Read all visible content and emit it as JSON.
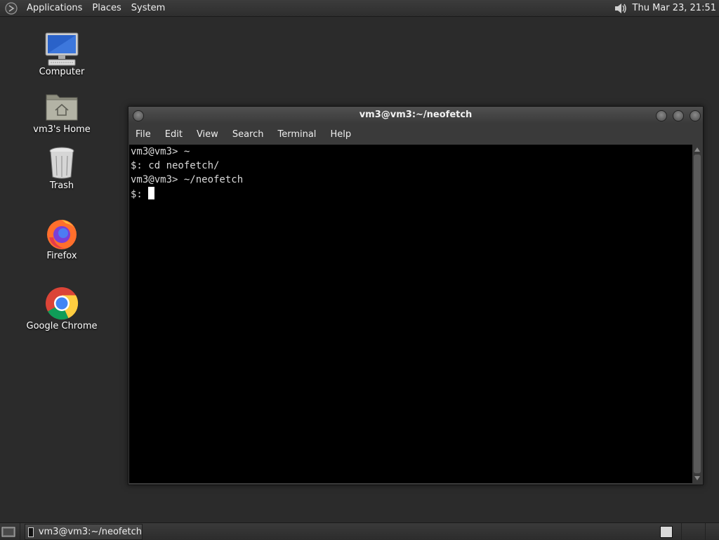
{
  "top_panel": {
    "menus": [
      "Applications",
      "Places",
      "System"
    ],
    "clock": "Thu Mar 23, 21:51",
    "icons": {
      "logo": "mate-logo-icon",
      "volume": "volume-icon"
    }
  },
  "desktop": {
    "icons": [
      {
        "label": "Computer",
        "icon": "computer-icon"
      },
      {
        "label": "vm3's Home",
        "icon": "home-folder-icon"
      },
      {
        "label": "Trash",
        "icon": "trash-icon"
      },
      {
        "label": "Firefox",
        "icon": "firefox-icon"
      },
      {
        "label": "Google Chrome",
        "icon": "chrome-icon"
      }
    ]
  },
  "terminal": {
    "title": "vm3@vm3:~/neofetch",
    "menus": [
      "File",
      "Edit",
      "View",
      "Search",
      "Terminal",
      "Help"
    ],
    "lines": [
      "vm3@vm3> ~",
      "$: cd neofetch/",
      "vm3@vm3> ~/neofetch",
      "$: "
    ]
  },
  "bottom_panel": {
    "task_label": "vm3@vm3:~/neofetch",
    "icons": {
      "show_desktop": "show-desktop-icon",
      "workspace": "workspace-switcher-icon"
    }
  },
  "colors": {
    "desktop_bg": "#2b2b2b",
    "panel_bg": "#333333",
    "terminal_bg": "#000000",
    "terminal_fg": "#d9d9d9"
  }
}
